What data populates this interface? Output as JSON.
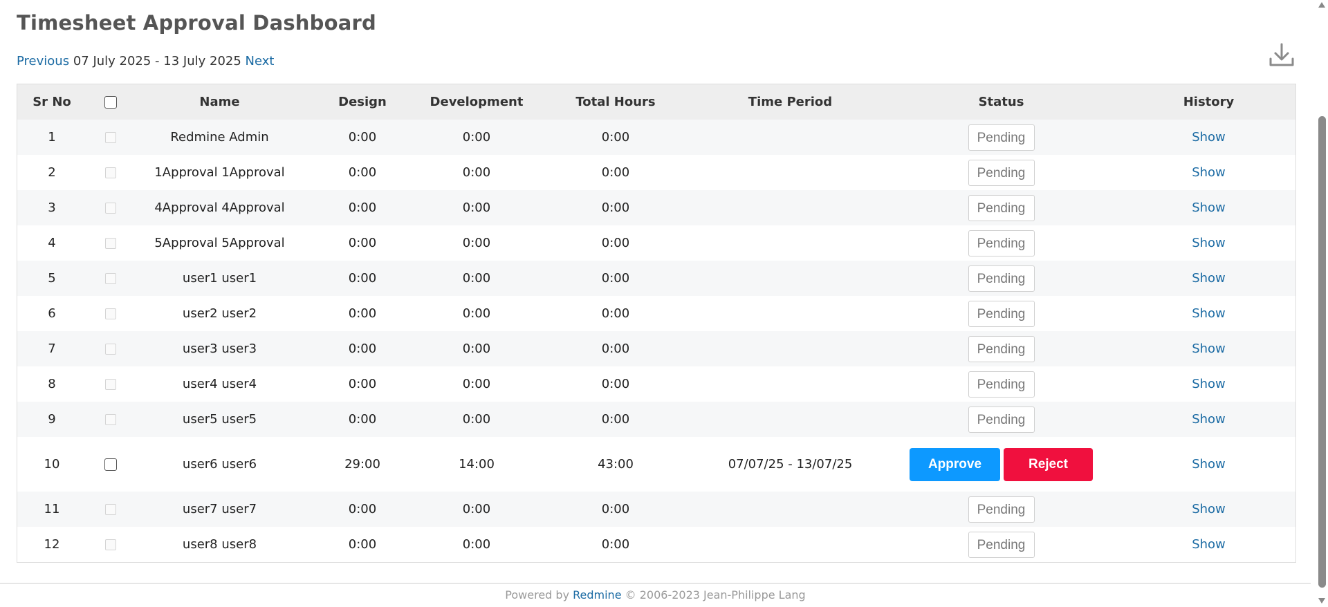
{
  "header": {
    "title": "Timesheet Approval Dashboard",
    "previous_label": "Previous",
    "date_range": "07 July 2025 - 13 July 2025",
    "next_label": "Next",
    "download_icon": "download-icon"
  },
  "table": {
    "columns": [
      "Sr No",
      "",
      "Name",
      "Design",
      "Development",
      "Total Hours",
      "Time Period",
      "Status",
      "History"
    ],
    "rows": [
      {
        "sr": "1",
        "name": "Redmine Admin",
        "design": "0:00",
        "development": "0:00",
        "total": "0:00",
        "period": "",
        "status": "Pending",
        "history": "Show"
      },
      {
        "sr": "2",
        "name": "1Approval 1Approval",
        "design": "0:00",
        "development": "0:00",
        "total": "0:00",
        "period": "",
        "status": "Pending",
        "history": "Show"
      },
      {
        "sr": "3",
        "name": "4Approval 4Approval",
        "design": "0:00",
        "development": "0:00",
        "total": "0:00",
        "period": "",
        "status": "Pending",
        "history": "Show"
      },
      {
        "sr": "4",
        "name": "5Approval 5Approval",
        "design": "0:00",
        "development": "0:00",
        "total": "0:00",
        "period": "",
        "status": "Pending",
        "history": "Show"
      },
      {
        "sr": "5",
        "name": "user1 user1",
        "design": "0:00",
        "development": "0:00",
        "total": "0:00",
        "period": "",
        "status": "Pending",
        "history": "Show"
      },
      {
        "sr": "6",
        "name": "user2 user2",
        "design": "0:00",
        "development": "0:00",
        "total": "0:00",
        "period": "",
        "status": "Pending",
        "history": "Show"
      },
      {
        "sr": "7",
        "name": "user3 user3",
        "design": "0:00",
        "development": "0:00",
        "total": "0:00",
        "period": "",
        "status": "Pending",
        "history": "Show"
      },
      {
        "sr": "8",
        "name": "user4 user4",
        "design": "0:00",
        "development": "0:00",
        "total": "0:00",
        "period": "",
        "status": "Pending",
        "history": "Show"
      },
      {
        "sr": "9",
        "name": "user5 user5",
        "design": "0:00",
        "development": "0:00",
        "total": "0:00",
        "period": "",
        "status": "Pending",
        "history": "Show"
      },
      {
        "sr": "10",
        "name": "user6 user6",
        "design": "29:00",
        "development": "14:00",
        "total": "43:00",
        "period": "07/07/25 - 13/07/25",
        "status": "actions",
        "approve_label": "Approve",
        "reject_label": "Reject",
        "history": "Show"
      },
      {
        "sr": "11",
        "name": "user7 user7",
        "design": "0:00",
        "development": "0:00",
        "total": "0:00",
        "period": "",
        "status": "Pending",
        "history": "Show"
      },
      {
        "sr": "12",
        "name": "user8 user8",
        "design": "0:00",
        "development": "0:00",
        "total": "0:00",
        "period": "",
        "status": "Pending",
        "history": "Show"
      }
    ]
  },
  "footer": {
    "powered_by": "Powered by",
    "link": "Redmine",
    "copyright": "© 2006-2023 Jean-Philippe Lang"
  },
  "colors": {
    "link": "#1a6aa3",
    "approve": "#0d99ff",
    "reject": "#f0103e"
  }
}
